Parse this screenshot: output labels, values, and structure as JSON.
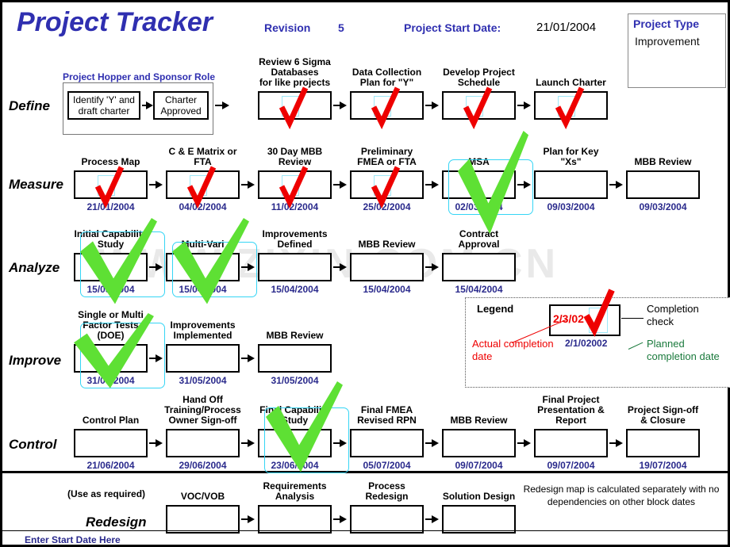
{
  "header": {
    "title": "Project Tracker",
    "revision_label": "Revision",
    "revision_value": "5",
    "start_date_label": "Project Start Date:",
    "start_date_value": "21/01/2004",
    "project_type_title": "Project Type",
    "project_type_value": "Improvement"
  },
  "colors": {
    "title_blue": "#2f2fb0",
    "date_blue": "#2a2a8c",
    "check_red": "#ee0000",
    "check_green": "#5ee034",
    "highlight_cyan": "#35d5f5"
  },
  "hopper": {
    "title": "Project Hopper and Sponsor Role",
    "steps": [
      {
        "label": "Identify 'Y' and\ndraft charter"
      },
      {
        "label": "Charter\nApproved"
      }
    ]
  },
  "rows": [
    {
      "phase": "Define",
      "steps": [
        {
          "label": "Review  6 Sigma\nDatabases\nfor like projects",
          "date": "",
          "check": "red",
          "highlight": false
        },
        {
          "label": "Data Collection\nPlan for \"Y\"",
          "date": "",
          "check": "red",
          "highlight": false
        },
        {
          "label": "Develop Project\nSchedule",
          "date": "",
          "check": "red",
          "highlight": false
        },
        {
          "label": "Launch Charter",
          "date": "",
          "check": "red",
          "highlight": false
        }
      ]
    },
    {
      "phase": "Measure",
      "steps": [
        {
          "label": "Process Map",
          "date": "21/01/2004",
          "check": "red",
          "highlight": false
        },
        {
          "label": "C & E Matrix or\nFTA",
          "date": "04/02/2004",
          "check": "red",
          "highlight": false
        },
        {
          "label": "30 Day MBB\nReview",
          "date": "11/02/2004",
          "check": "red",
          "highlight": false
        },
        {
          "label": "Preliminary\nFMEA or FTA",
          "date": "25/02/2004",
          "check": "red",
          "highlight": false
        },
        {
          "label": "MSA",
          "date": "02/03/2004",
          "check": "green",
          "highlight": true
        },
        {
          "label": "Plan for Key\n\"Xs\"",
          "date": "09/03/2004",
          "check": "none",
          "highlight": false
        },
        {
          "label": "MBB Review",
          "date": "09/03/2004",
          "check": "none",
          "highlight": false
        }
      ]
    },
    {
      "phase": "Analyze",
      "steps": [
        {
          "label": "Initial Capability\nStudy",
          "date": "15/03/2004",
          "check": "green",
          "highlight": true
        },
        {
          "label": "Multi-Vari",
          "date": "15/04/2004",
          "check": "green",
          "highlight": true
        },
        {
          "label": "Improvements\nDefined",
          "date": "15/04/2004",
          "check": "none",
          "highlight": false
        },
        {
          "label": "MBB Review",
          "date": "15/04/2004",
          "check": "none",
          "highlight": false
        },
        {
          "label": "Contract\nApproval",
          "date": "15/04/2004",
          "check": "none",
          "highlight": false
        }
      ]
    },
    {
      "phase": "Improve",
      "steps": [
        {
          "label": "Single or Multi\nFactor Tests\n(DOE)",
          "date": "31/05/2004",
          "check": "green",
          "highlight": true
        },
        {
          "label": "Improvements\nImplemented",
          "date": "31/05/2004",
          "check": "none",
          "highlight": false
        },
        {
          "label": "MBB Review",
          "date": "31/05/2004",
          "check": "none",
          "highlight": false
        }
      ]
    },
    {
      "phase": "Control",
      "steps": [
        {
          "label": "Control Plan",
          "date": "21/06/2004",
          "check": "none",
          "highlight": false
        },
        {
          "label": "Hand Off\nTraining/Process\nOwner Sign-off",
          "date": "29/06/2004",
          "check": "none",
          "highlight": false
        },
        {
          "label": "Final Capability\nStudy",
          "date": "23/06/2004",
          "check": "green",
          "highlight": true
        },
        {
          "label": "Final FMEA\nRevised RPN",
          "date": "05/07/2004",
          "check": "none",
          "highlight": false
        },
        {
          "label": "MBB Review",
          "date": "09/07/2004",
          "check": "none",
          "highlight": false
        },
        {
          "label": "Final Project\nPresentation &\nReport",
          "date": "09/07/2004",
          "check": "none",
          "highlight": false
        },
        {
          "label": "Project Sign-off\n& Closure",
          "date": "19/07/2004",
          "check": "none",
          "highlight": false
        }
      ]
    },
    {
      "phase": "Redesign",
      "steps": [
        {
          "label": "VOC/VOB",
          "date": "",
          "check": "none",
          "highlight": false
        },
        {
          "label": "Requirements\nAnalysis",
          "date": "",
          "check": "none",
          "highlight": false
        },
        {
          "label": "Process\nRedesign",
          "date": "",
          "check": "none",
          "highlight": false
        },
        {
          "label": "Solution Design",
          "date": "",
          "check": "none",
          "highlight": false
        }
      ]
    }
  ],
  "legend": {
    "title": "Legend",
    "actual_date_sample": "2/3/02",
    "planned_date_sample": "2/1/02002",
    "completion_check_label": "Completion\ncheck",
    "actual_label": "Actual completion\ndate",
    "planned_label": "Planned\ncompletion date"
  },
  "footer": {
    "use_as_required": "(Use as required)",
    "enter_start_date": "Enter Start Date Here",
    "redesign_note": "Redesign map is calculated separately with no dependencies on other block dates"
  },
  "watermark": "WWW.ZIXIN.COM.CN"
}
